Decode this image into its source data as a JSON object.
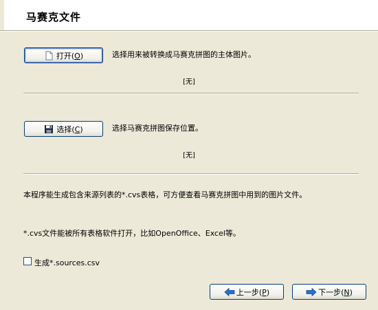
{
  "header": {
    "title": "马赛克文件"
  },
  "open_section": {
    "button_label": "打开",
    "button_mnemonic": "O",
    "description": "选择用来被转换成马赛克拼图的主体图片。",
    "status": "[无]"
  },
  "save_section": {
    "button_label": "选择",
    "button_mnemonic": "C",
    "description": "选择马赛克拼图保存位置。",
    "status": "[无]"
  },
  "notes": {
    "line1": "本程序能生成包含来源列表的*.cvs表格，可方便查看马赛克拼图中用到的图片文件。",
    "line2": "*.cvs文件能被所有表格软件打开，比如OpenOffice、Excel等。"
  },
  "option": {
    "label": "生成*.sources.csv",
    "checked": false
  },
  "nav": {
    "back_label": "上一步",
    "back_mnemonic": "P",
    "next_label": "下一步",
    "next_mnemonic": "N"
  },
  "icons": {
    "open": "open-file-icon",
    "save": "floppy-disk-icon",
    "back": "arrow-left-icon",
    "next": "arrow-right-icon"
  },
  "colors": {
    "accent_blue": "#1e66c8",
    "border_blue": "#003c74"
  }
}
